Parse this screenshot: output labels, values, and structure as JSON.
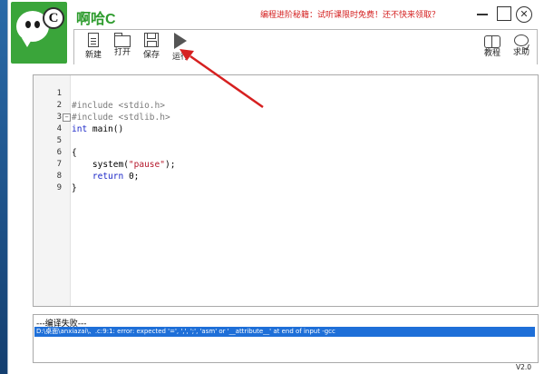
{
  "app": {
    "title": "啊哈C",
    "logo_letter": "C"
  },
  "promo_text": "编程进阶秘籍：试听课限时免费！还不快来领取？",
  "toolbar": [
    {
      "label": "新建",
      "icon": "new-file-icon"
    },
    {
      "label": "打开",
      "icon": "folder-open-icon"
    },
    {
      "label": "保存",
      "icon": "save-icon"
    },
    {
      "label": "运行",
      "icon": "run-play-icon"
    },
    {
      "label": "教程",
      "icon": "book-icon"
    },
    {
      "label": "求助",
      "icon": "chat-bubble-icon"
    }
  ],
  "editor": {
    "lines": [
      {
        "num": "1",
        "text": "#include <stdio.h>"
      },
      {
        "num": "2",
        "text": "#include <stdlib.h>"
      },
      {
        "num": "3",
        "kw": "int",
        "rest": " main()"
      },
      {
        "num": "4",
        "fold": "−",
        "text": "{"
      },
      {
        "num": "5",
        "text": ""
      },
      {
        "num": "6",
        "pre": "    system(",
        "str": "\"pause\"",
        "post": ");"
      },
      {
        "num": "7",
        "pre": "    ",
        "kw": "return",
        "rest": " 0;"
      },
      {
        "num": "8",
        "text": "}"
      },
      {
        "num": "9",
        "text": ""
      }
    ]
  },
  "output": {
    "header": "---编译失败---",
    "error": "D:\\桌面\\anxiazai\\、.c:9:1: error: expected '=', ',', ';', 'asm' or '__attribute__' at end of input -gcc"
  },
  "version": "V2.0",
  "colors": {
    "title_green": "#2e9c2e",
    "promo_red": "#d42020",
    "error_highlight": "#1e6fd8",
    "arrow_red": "#d62020"
  }
}
